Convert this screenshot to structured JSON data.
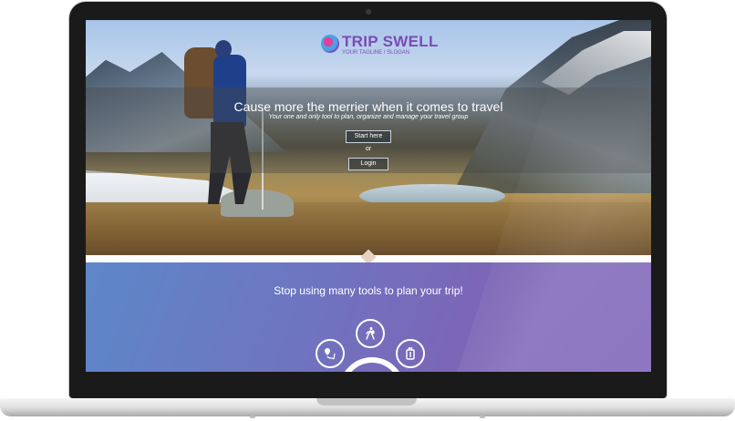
{
  "logo": {
    "title": "TRIP SWELL",
    "tagline": "YOUR TAGLINE / SLOGAN"
  },
  "hero": {
    "title": "Cause more the merrier when it comes to travel",
    "subtitle": "Your one and only tool to plan, organize and manage your travel group",
    "start_label": "Start here",
    "or_label": "or",
    "login_label": "Login"
  },
  "section": {
    "title": "Stop using many tools to plan your trip!"
  },
  "features": [
    {
      "icon": "map-pin-route-icon"
    },
    {
      "icon": "hiker-icon"
    },
    {
      "icon": "luggage-icon"
    }
  ]
}
